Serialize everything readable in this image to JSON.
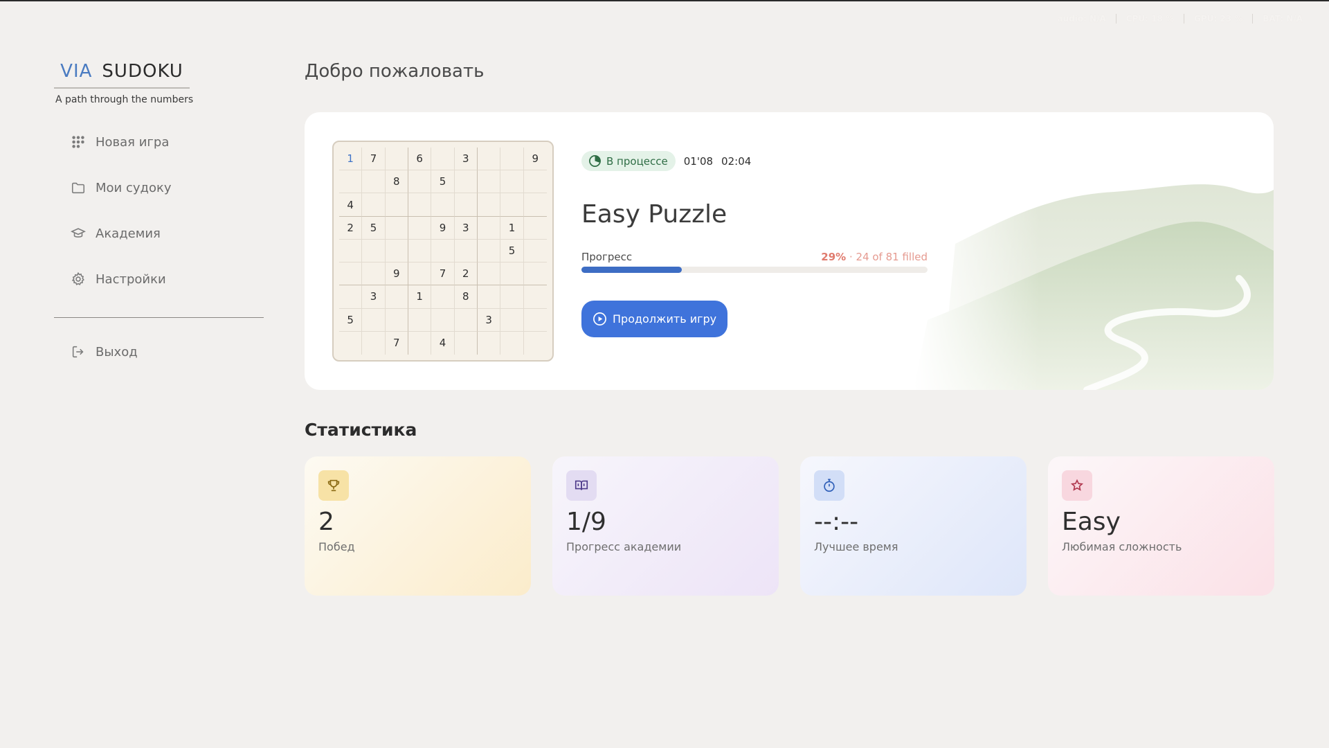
{
  "status_bar": {
    "items": [
      "audio: N/A",
      "CPU: 18 %",
      "GPU: 23 %",
      "BAT: N/A"
    ]
  },
  "brand": {
    "via": "VIA",
    "name": "SUDOKU",
    "tagline": "A path through the numbers"
  },
  "sidebar": {
    "items": [
      {
        "label": "Новая игра",
        "icon": "grid-dots-icon"
      },
      {
        "label": "Мои судоку",
        "icon": "folder-icon"
      },
      {
        "label": "Академия",
        "icon": "graduation-cap-icon"
      },
      {
        "label": "Настройки",
        "icon": "gear-icon"
      }
    ],
    "logout": {
      "label": "Выход",
      "icon": "logout-icon"
    }
  },
  "page_title": "Добро пожаловать",
  "current_game": {
    "status": "В процессе",
    "elapsed": "01'08",
    "clock": "02:04",
    "title": "Easy Puzzle",
    "progress_label": "Прогресс",
    "progress_percent": "29%",
    "progress_fraction": 0.29,
    "progress_detail": "· 24 of 81 filled",
    "continue_label": "Продолжить игру",
    "board": [
      [
        "1",
        "7",
        "",
        "6",
        "",
        "3",
        "",
        "",
        "9"
      ],
      [
        "",
        "",
        "8",
        "",
        "5",
        "",
        "",
        "",
        ""
      ],
      [
        "4",
        "",
        "",
        "",
        "",
        "",
        "",
        "",
        ""
      ],
      [
        "2",
        "5",
        "",
        "",
        "9",
        "3",
        "",
        "1",
        ""
      ],
      [
        "",
        "",
        "",
        "",
        "",
        "",
        "",
        "5",
        ""
      ],
      [
        "",
        "",
        "9",
        "",
        "7",
        "2",
        "",
        "",
        ""
      ],
      [
        "",
        "3",
        "",
        "1",
        "",
        "8",
        "",
        "",
        ""
      ],
      [
        "5",
        "",
        "",
        "",
        "",
        "",
        "3",
        "",
        ""
      ],
      [
        "",
        "",
        "7",
        "",
        "4",
        "",
        "",
        "",
        ""
      ]
    ],
    "selected_cell": [
      0,
      0
    ],
    "accent_color": "#3f73db"
  },
  "stats": {
    "title": "Статистика",
    "cards": [
      {
        "value": "2",
        "label": "Побед",
        "icon": "trophy-icon",
        "key": "wins"
      },
      {
        "value": "1/9",
        "label": "Прогресс академии",
        "icon": "book-icon",
        "key": "academy"
      },
      {
        "value": "--:--",
        "label": "Лучшее время",
        "icon": "stopwatch-icon",
        "key": "best"
      },
      {
        "value": "Easy",
        "label": "Любимая сложность",
        "icon": "star-icon",
        "key": "diff"
      }
    ]
  }
}
